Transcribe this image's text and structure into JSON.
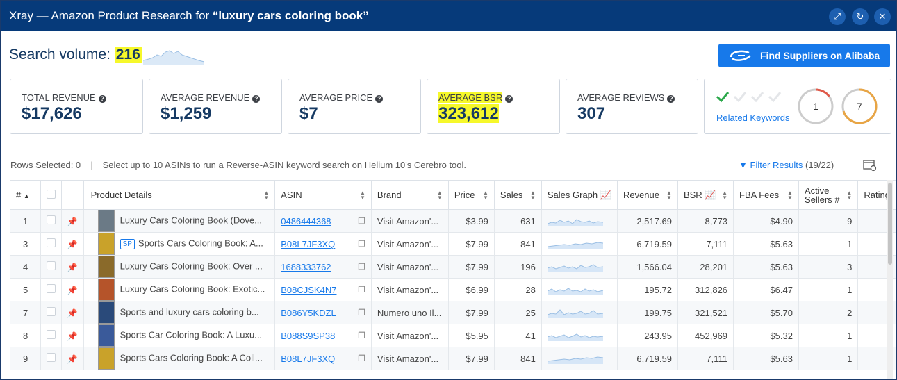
{
  "header": {
    "title_prefix": "Xray — Amazon Product Research for ",
    "title_query": "“luxury cars coloring book”",
    "buttons": [
      "expand",
      "refresh",
      "close"
    ]
  },
  "search_volume": {
    "label": "Search volume:",
    "value": "216"
  },
  "alibaba_button": {
    "label": "Find Suppliers on Alibaba"
  },
  "cards": [
    {
      "label": "TOTAL REVENUE",
      "value": "$17,626"
    },
    {
      "label": "AVERAGE REVENUE",
      "value": "$1,259"
    },
    {
      "label": "AVERAGE PRICE",
      "value": "$7"
    },
    {
      "label": "AVERAGE BSR",
      "value": "323,612"
    },
    {
      "label": "AVERAGE REVIEWS",
      "value": "307"
    }
  ],
  "keywords": {
    "link": "Related Keywords",
    "score1": "1",
    "score2": "7",
    "checks_on": 1,
    "checks_total": 4,
    "score1_fill": 0.15,
    "score2_fill": 0.7
  },
  "toolbar": {
    "rows_selected": "Rows Selected: 0",
    "hint": "Select up to 10 ASINs to run a Reverse-ASIN keyword search on Helium 10's Cerebro tool.",
    "filter": "Filter Results",
    "filter_count": "(19/22)"
  },
  "table": {
    "headers": [
      "#",
      "",
      "",
      "Product Details",
      "ASIN",
      "Brand",
      "Price",
      "Sales",
      "Sales Graph",
      "Revenue",
      "BSR",
      "FBA Fees",
      "Active Sellers #",
      "Rating"
    ],
    "rows": [
      {
        "n": "1",
        "title": "Luxury Cars Coloring Book (Dove...",
        "sp": false,
        "asin": "0486444368",
        "brand": "Visit Amazon'...",
        "price": "$3.99",
        "sales": "631",
        "revenue": "2,517.69",
        "bsr": "8,773",
        "fba": "$4.90",
        "sellers": "9",
        "color": "#6b7a86"
      },
      {
        "n": "3",
        "title": "Sports Cars Coloring Book: A...",
        "sp": true,
        "asin": "B08L7JF3XQ",
        "brand": "Visit Amazon'...",
        "price": "$7.99",
        "sales": "841",
        "revenue": "6,719.59",
        "bsr": "7,111",
        "fba": "$5.63",
        "sellers": "1",
        "color": "#c9a22a"
      },
      {
        "n": "4",
        "title": "Luxury Cars Coloring Book: Over ...",
        "sp": false,
        "asin": "1688333762",
        "brand": "Visit Amazon'...",
        "price": "$7.99",
        "sales": "196",
        "revenue": "1,566.04",
        "bsr": "28,201",
        "fba": "$5.63",
        "sellers": "3",
        "color": "#8a6a2a"
      },
      {
        "n": "5",
        "title": "Luxury Cars Coloring Book: Exotic...",
        "sp": false,
        "asin": "B08CJSK4N7",
        "brand": "Visit Amazon'...",
        "price": "$6.99",
        "sales": "28",
        "revenue": "195.72",
        "bsr": "312,826",
        "fba": "$6.47",
        "sellers": "1",
        "color": "#b5542a"
      },
      {
        "n": "7",
        "title": "Sports and luxury cars coloring b...",
        "sp": false,
        "asin": "B086Y5KDZL",
        "brand": "Numero uno Il...",
        "price": "$7.99",
        "sales": "25",
        "revenue": "199.75",
        "bsr": "321,521",
        "fba": "$5.70",
        "sellers": "2",
        "color": "#2a4a7a"
      },
      {
        "n": "8",
        "title": "Sports Car Coloring Book: A Luxu...",
        "sp": false,
        "asin": "B088S9SP38",
        "brand": "Visit Amazon'...",
        "price": "$5.95",
        "sales": "41",
        "revenue": "243.95",
        "bsr": "452,969",
        "fba": "$5.32",
        "sellers": "1",
        "color": "#3a5a9a"
      },
      {
        "n": "9",
        "title": "Sports Cars Coloring Book: A Coll...",
        "sp": false,
        "asin": "B08L7JF3XQ",
        "brand": "Visit Amazon'...",
        "price": "$7.99",
        "sales": "841",
        "revenue": "6,719.59",
        "bsr": "7,111",
        "fba": "$5.63",
        "sellers": "1",
        "color": "#c9a22a"
      }
    ]
  },
  "colors": {
    "header": "#063a7a",
    "accent": "#1779ea",
    "highlight": "#f6f82a",
    "ring1": "#e05a4a",
    "ring2": "#e8a545"
  }
}
